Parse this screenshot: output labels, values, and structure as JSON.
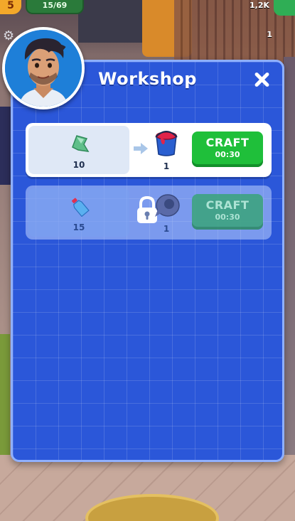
{
  "hud": {
    "level": "5",
    "xp": "15/69",
    "coins": "1,2K",
    "boost_count": "1"
  },
  "workshop": {
    "title": "Workshop",
    "recipes": [
      {
        "ingredient_icon": "green-glass-shard-icon",
        "ingredient_count": "10",
        "output_icon": "red-paint-bucket-icon",
        "output_count": "1",
        "craft_label": "CRAFT",
        "craft_time": "00:30",
        "locked": false
      },
      {
        "ingredient_icon": "blue-plastic-bottle-icon",
        "ingredient_count": "15",
        "output_icon": "tape-roll-icon",
        "output_count": "1",
        "craft_label": "CRAFT",
        "craft_time": "00:30",
        "locked": true
      }
    ]
  },
  "colors": {
    "panel": "#2b57d9",
    "craft_active": "#1fbf3a",
    "craft_locked": "#3aa47a"
  }
}
